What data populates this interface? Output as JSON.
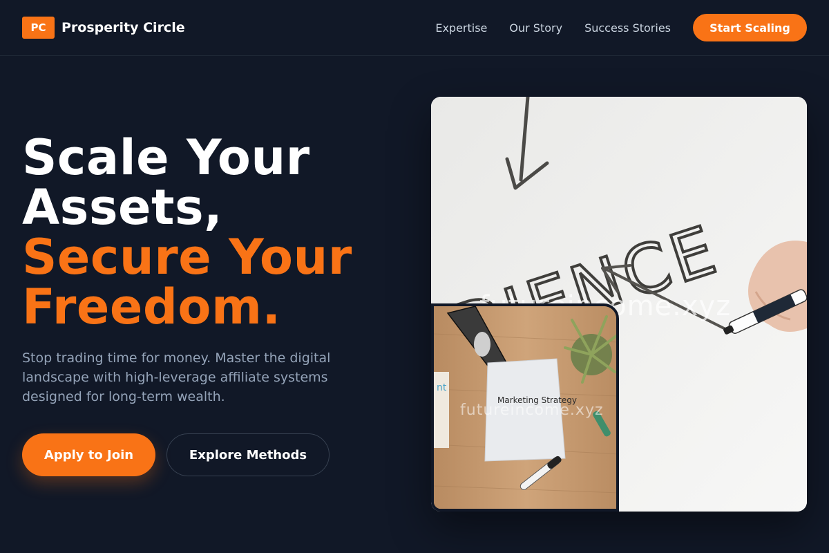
{
  "header": {
    "logo_badge": "PC",
    "brand_name": "Prosperity Circle",
    "nav": [
      "Expertise",
      "Our Story",
      "Success Stories"
    ],
    "cta": "Start Scaling"
  },
  "hero": {
    "title_lines": [
      "Scale Your",
      "Assets,"
    ],
    "accent_lines": [
      "Secure Your",
      "Freedom."
    ],
    "subtitle": "Stop trading time for money. Master the digital landscape with high-leverage affiliate systems designed for long-term wealth.",
    "primary_button": "Apply to Join",
    "secondary_button": "Explore Methods"
  },
  "images": {
    "main_handwriting": "DIENCE",
    "main_watermark": "futureincome.xyz",
    "inset_note": "Marketing Strategy",
    "inset_watermark": "futureincome.xyz"
  },
  "colors": {
    "background": "#111827",
    "accent": "#f97316",
    "muted_text": "#94a3b8",
    "nav_text": "#cbd5e1"
  }
}
